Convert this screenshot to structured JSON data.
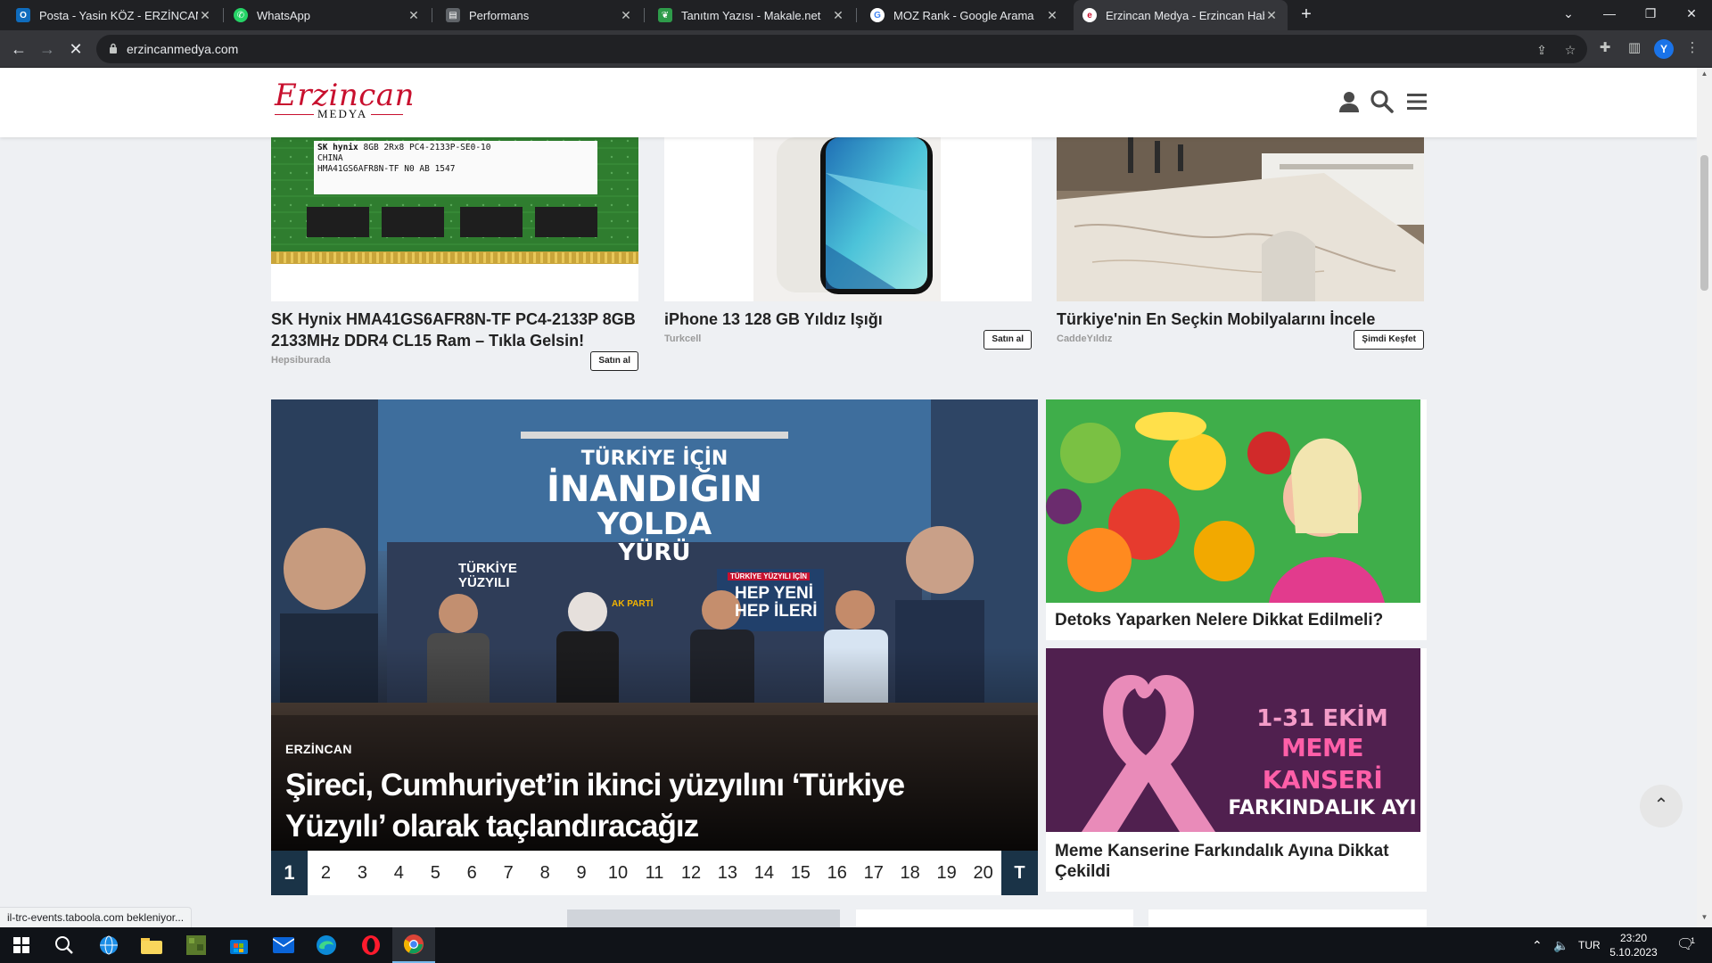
{
  "browser": {
    "tabs": [
      {
        "title": "Posta - Yasin KÖZ - ERZİNCAN -",
        "icon": "outlook-icon",
        "color": "#0f6cbd"
      },
      {
        "title": "WhatsApp",
        "icon": "whatsapp-icon",
        "color": "#25d366"
      },
      {
        "title": "Performans",
        "icon": "performance-icon",
        "color": "#5f6368"
      },
      {
        "title": "Tanıtım Yazısı - Makale.net",
        "icon": "leaf-icon",
        "color": "#2e9b4a"
      },
      {
        "title": "MOZ Rank - Google Arama",
        "icon": "google-icon",
        "color": "#ffffff"
      },
      {
        "title": "Erzincan Medya - Erzincan Haber",
        "icon": "erzincan-icon",
        "color": "#c8102e"
      }
    ],
    "url": "erzincanmedya.com",
    "profile_initial": "Y",
    "status": "il-trc-events.taboola.com bekleniyor..."
  },
  "site": {
    "logo_main": "Erzincan",
    "logo_sub": "MEDYA",
    "brand_color": "#c8102e",
    "accent_dark": "#1a3347"
  },
  "ads": [
    {
      "title": "SK Hynix HMA41GS6AFR8N-TF PC4-2133P 8GB 2133MHz DDR4 CL15 Ram – Tıkla Gelsin!",
      "source": "Hepsiburada",
      "cta": "Satın al"
    },
    {
      "title": "iPhone 13 128 GB Yıldız Işığı",
      "source": "Turkcell",
      "cta": "Satın al"
    },
    {
      "title": "Türkiye'nin En Seçkin Mobilyalarını İncele",
      "source": "CaddeYıldız",
      "cta": "Şimdi Keşfet"
    }
  ],
  "ram_label": {
    "brand": "SK hynix",
    "line1": "8GB 2Rx8 PC4-2133P-SE0-10",
    "line2": "HMA41GS6AFR8N-TF N0 AB",
    "code": "1547",
    "country": "CHINA"
  },
  "slider": {
    "category": "ERZİNCAN",
    "title": "Şireci, Cumhuriyet’in ikinci yüzyılını ‘Türkiye Yüzyılı’ olarak taçlandıracağız",
    "banner_line1": "TÜRKİYE İÇİN",
    "banner_line2": "İNANDIĞIN",
    "banner_line3": "YOLDA",
    "banner_line4": "YÜRÜ",
    "sign_left": "TÜRKİYE YÜZYILI",
    "sign_party": "AK PARTİ",
    "sign_right_small": "TÜRKİYE YÜZYILI İÇİN",
    "sign_right_1": "HEP YENİ",
    "sign_right_2": "HEP İLERİ",
    "pages": [
      "1",
      "2",
      "3",
      "4",
      "5",
      "6",
      "7",
      "8",
      "9",
      "10",
      "11",
      "12",
      "13",
      "14",
      "15",
      "16",
      "17",
      "18",
      "19",
      "20",
      "T"
    ],
    "active_page": "1"
  },
  "side_news": [
    {
      "title": "Detoks Yaparken Nelere Dikkat Edilmeli?"
    },
    {
      "title": "Meme Kanserine Farkındalık Ayına Dikkat Çekildi",
      "img_line1": "1-31 EKİM",
      "img_line2": "MEME KANSERİ",
      "img_line3": "FARKINDALIK AYI"
    }
  ],
  "taskbar": {
    "lang": "TUR",
    "time": "23:20",
    "date": "5.10.2023",
    "notif_count": "1"
  }
}
